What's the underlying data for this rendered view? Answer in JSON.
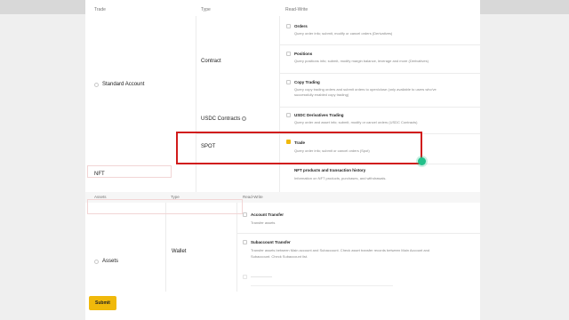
{
  "headers": {
    "trade": "Trade",
    "type": "Type",
    "read_write": "Read-Write"
  },
  "left": {
    "standard_account": "Standard Account",
    "nft": "NFT",
    "assets": "Assets"
  },
  "types": {
    "contract": "Contract",
    "usdc_contracts": "USDC Contracts",
    "spot": "SPOT",
    "wallet": "Wallet"
  },
  "permissions": {
    "orders": {
      "title": "Orders",
      "desc": "Query order info; submit, modify or cancel orders (Derivatives)"
    },
    "positions": {
      "title": "Positions",
      "desc": "Query positions info; submit, modify margin balance, leverage and more (Derivatives)"
    },
    "copy_trading": {
      "title": "Copy Trading",
      "desc1": "Query copy trading orders and submit orders to open/close (only available to users who've",
      "desc2": "successfully enabled copy trading)"
    },
    "usdc_derivatives": {
      "title": "USDC Derivatives Trading",
      "desc": "Query order and asset info; submit, modify or cancel orders (USDC Contracts)"
    },
    "trade": {
      "title": "Trade",
      "desc": "Query order info; submit or cancel orders (Spot)",
      "checked": true
    },
    "nft": {
      "title": "NFT products and transaction history",
      "desc": "Information on NFT products, purchases, and withdrawals."
    },
    "account_transfer": {
      "title": "Account Transfer",
      "desc": "Transfer assets"
    },
    "subaccount_transfer": {
      "title": "Subaccount Transfer",
      "desc1": "Transfer assets between Main account and Subaccount. Check asset transfer records between Main Account and",
      "desc2": "Subaccount. Check Subaccount list."
    }
  },
  "assets_table": {
    "assets": "Assets",
    "type": "Type",
    "read_write": "Read-Write"
  },
  "submit_label": "Submit",
  "colors": {
    "accent": "#f0b90b",
    "highlight": "#d11b1b",
    "cursor": "#22c08a"
  }
}
